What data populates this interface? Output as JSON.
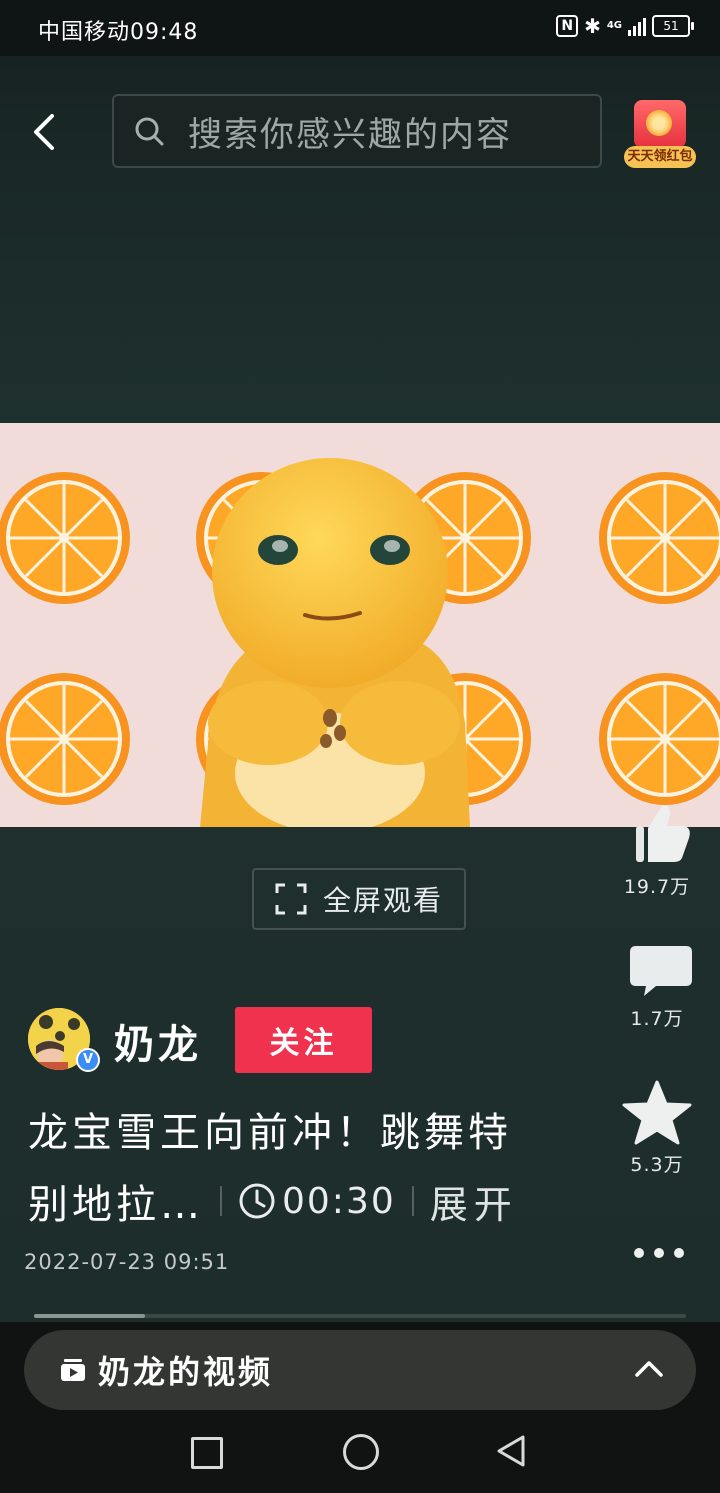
{
  "status_bar": {
    "carrier_time": "中国移动09:48",
    "network": "4G",
    "battery": "51"
  },
  "search": {
    "placeholder": "搜索你感兴趣的内容"
  },
  "promo": {
    "label": "天天领红包"
  },
  "video": {
    "fullscreen_label": "全屏观看",
    "progress": 0.17
  },
  "actions": {
    "likes": "19.7万",
    "comments": "1.7万",
    "favorites": "5.3万"
  },
  "author": {
    "name": "奶龙",
    "follow_label": "关注"
  },
  "caption": {
    "line1": "龙宝雪王向前冲！跳舞特",
    "line2": "别地拉…",
    "duration": "00:30",
    "expand": "展开",
    "date": "2022-07-23 09:51"
  },
  "collection": {
    "label": "奶龙的视频"
  },
  "colors": {
    "follow": "#f1324e",
    "background": "#1d2b29",
    "orange": "#f7931e",
    "character": "#f7c340"
  }
}
